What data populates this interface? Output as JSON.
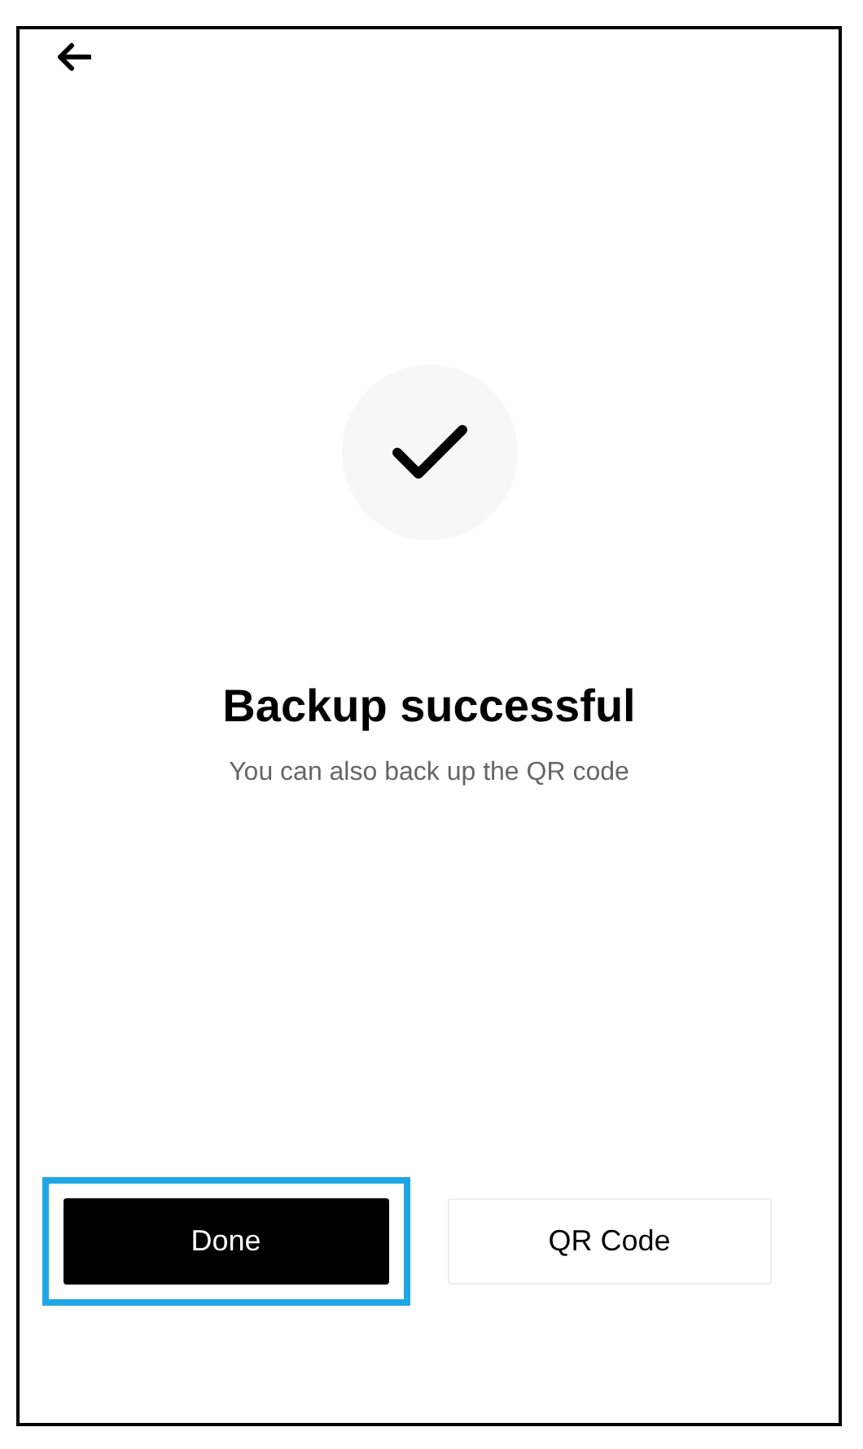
{
  "title": "Backup successful",
  "subtitle": "You can also back up the QR code",
  "buttons": [
    {
      "label": "Done",
      "kind": "primary",
      "highlighted": true
    },
    {
      "label": "QR Code",
      "kind": "secondary",
      "highlighted": false
    }
  ]
}
